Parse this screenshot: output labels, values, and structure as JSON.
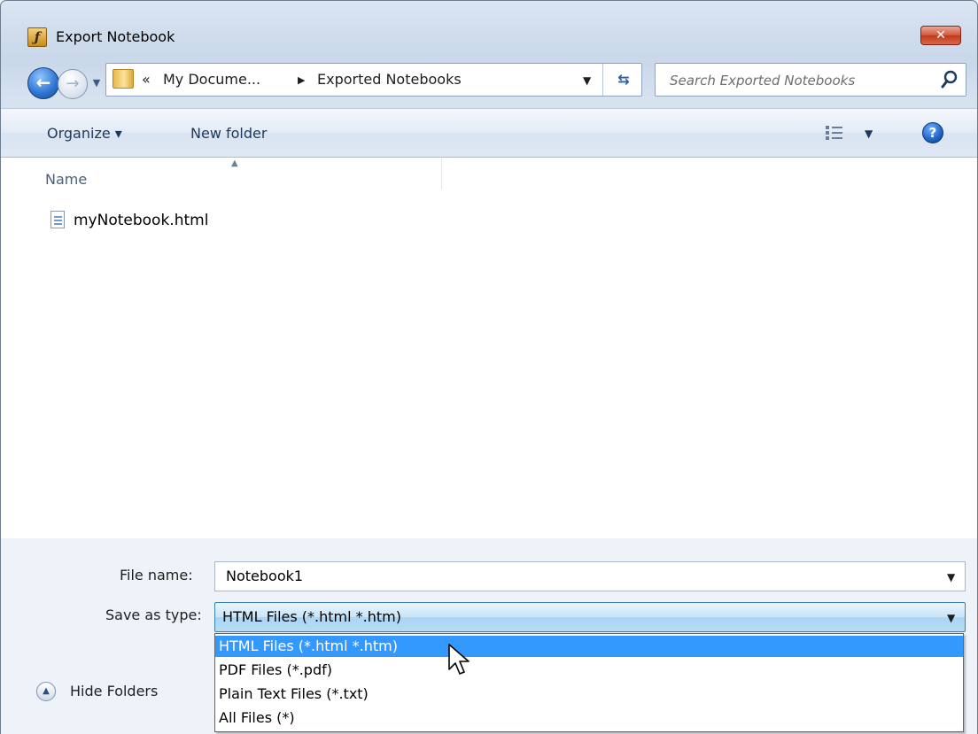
{
  "window": {
    "title": "Export Notebook",
    "title_icon": "notebook-app-icon",
    "close_label": "✕"
  },
  "nav": {
    "back_icon": "back-arrow-icon",
    "forward_icon": "forward-arrow-icon",
    "history_icon": "recent-pages-dropdown-icon",
    "address": {
      "chevrons": "«",
      "segments": [
        "My Docume...",
        "Exported Notebooks"
      ],
      "separator": "▶",
      "dropdown": "▼"
    },
    "refresh_icon": "refresh-icon",
    "search_placeholder": "Search Exported Notebooks"
  },
  "command_bar": {
    "organize_label": "Organize ▾",
    "new_folder_label": "New folder",
    "views_arrow": "▼",
    "help_label": "?"
  },
  "file_list": {
    "column_name": "Name",
    "items": [
      {
        "name": "myNotebook.html",
        "icon": "html-file-icon"
      }
    ]
  },
  "form": {
    "file_name_label": "File name:",
    "file_name_value": "Notebook1",
    "save_type_label": "Save as type:",
    "save_type_value": "HTML Files (*.html *.htm)",
    "arrow": "▼",
    "save_type_options": [
      "HTML Files (*.html *.htm)",
      "PDF Files (*.pdf)",
      "Plain Text Files (*.txt)",
      "All Files (*)"
    ],
    "selected_option_index": 0
  },
  "hide_folders": {
    "label": "Hide Folders",
    "icon": "collapse-up-icon",
    "icon_glyph": "▲"
  },
  "colors": {
    "selection": "#3399ff",
    "close_button": "#c0391d",
    "window_frame": "#cfdcec"
  }
}
